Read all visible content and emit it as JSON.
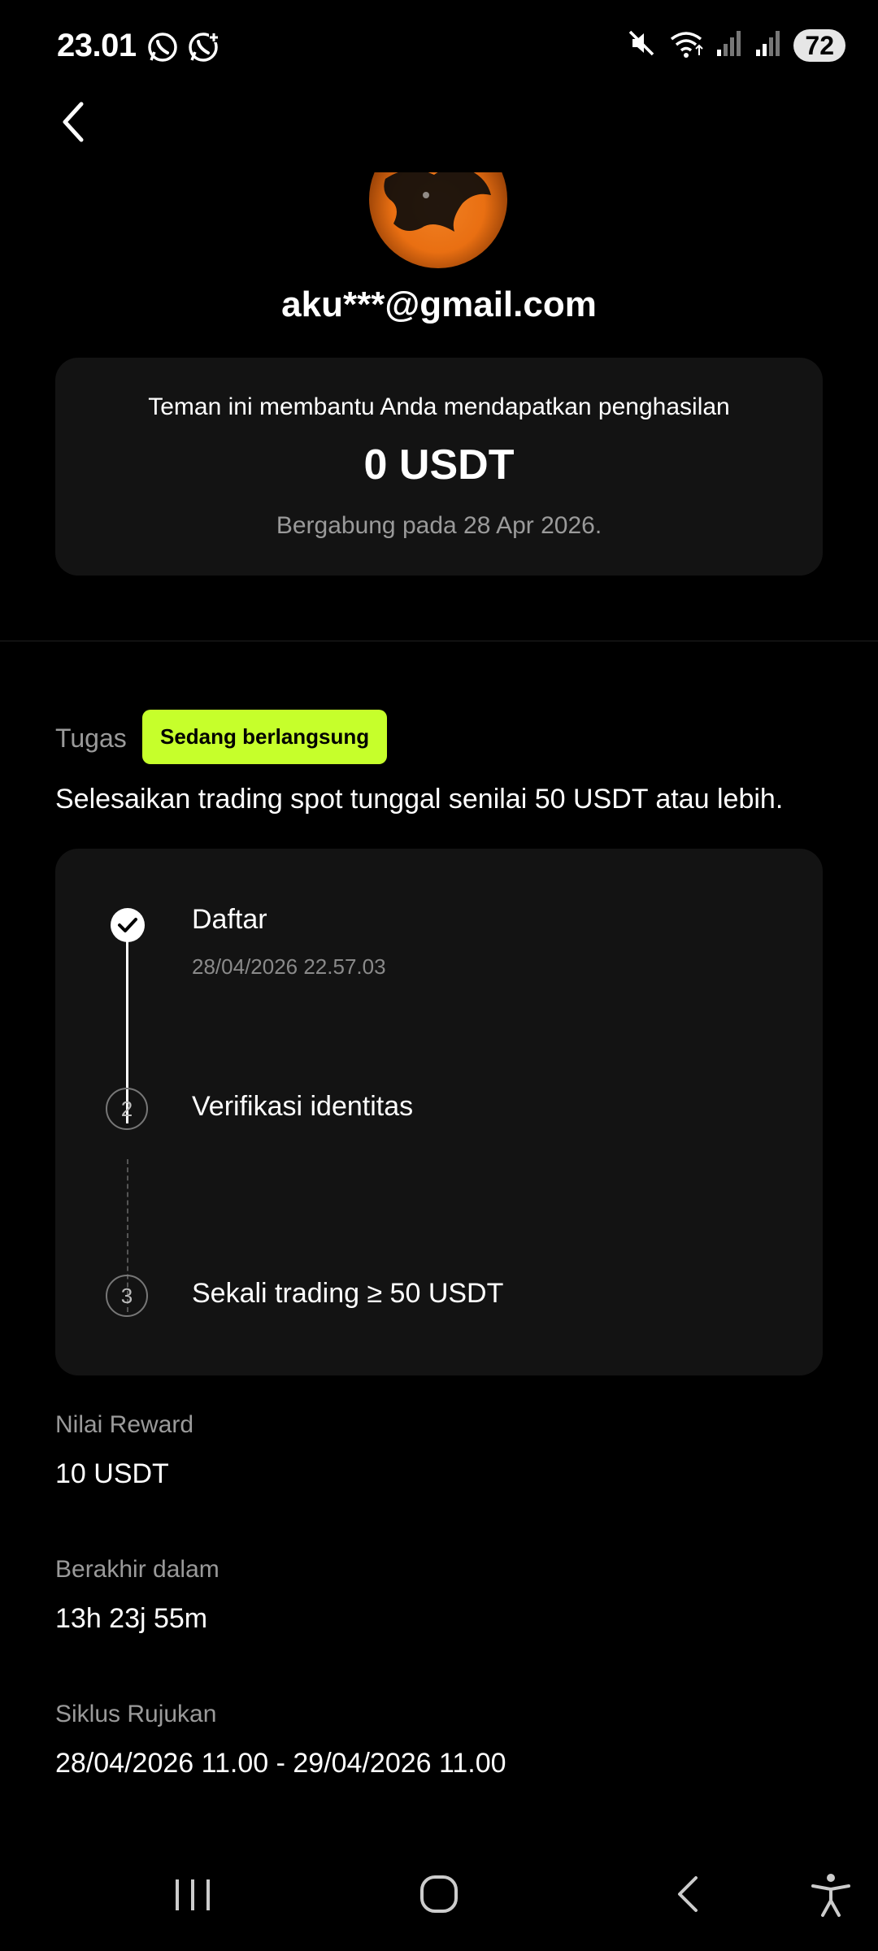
{
  "status_bar": {
    "time": "23.01",
    "battery": "72",
    "icons": [
      "whatsapp-icon",
      "whatsapp-business-icon",
      "mute-icon",
      "wifi-icon",
      "signal-icon",
      "signal-icon"
    ]
  },
  "profile": {
    "email": "aku***@gmail.com"
  },
  "earnings": {
    "caption": "Teman ini membantu Anda mendapatkan penghasilan",
    "amount": "0 USDT",
    "joined": "Bergabung pada 28 Apr 2026."
  },
  "task": {
    "label": "Tugas",
    "status": "Sedang berlangsung",
    "description": "Selesaikan trading spot tunggal senilai 50 USDT atau lebih.",
    "steps": [
      {
        "number": "",
        "title": "Daftar",
        "date": "28/04/2026 22.57.03",
        "done": true
      },
      {
        "number": "2",
        "title": "Verifikasi identitas",
        "date": "",
        "done": false
      },
      {
        "number": "3",
        "title": "Sekali trading ≥ 50 USDT",
        "date": "",
        "done": false
      }
    ]
  },
  "info": {
    "reward_label": "Nilai Reward",
    "reward_value": "10 USDT",
    "ends_label": "Berakhir dalam",
    "ends_value": "13h 23j 55m",
    "cycle_label": "Siklus Rujukan",
    "cycle_value": "28/04/2026 11.00 - 29/04/2026 11.00"
  },
  "colors": {
    "accent": "#c6ff2b",
    "background": "#000000",
    "card": "#131313",
    "avatar_orange": "#e96f12"
  }
}
